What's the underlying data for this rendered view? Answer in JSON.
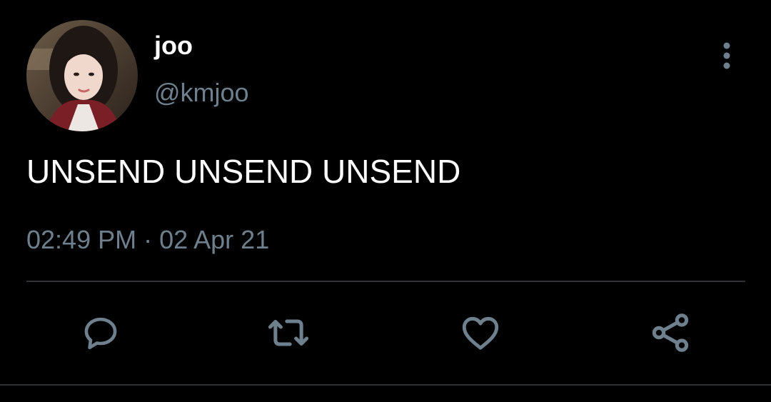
{
  "tweet": {
    "display_name": "joo",
    "handle": "@kmjoo",
    "text": "UNSEND UNSEND UNSEND",
    "time": "02:49 PM",
    "separator": "·",
    "date": "02 Apr 21"
  },
  "icons": {
    "more": "more-vertical-icon",
    "reply": "reply-icon",
    "retweet": "retweet-icon",
    "like": "heart-icon",
    "share": "share-icon"
  },
  "colors": {
    "background": "#000000",
    "primary_text": "#ffffff",
    "secondary_text": "#6e7f8d",
    "divider": "#2f3336"
  }
}
